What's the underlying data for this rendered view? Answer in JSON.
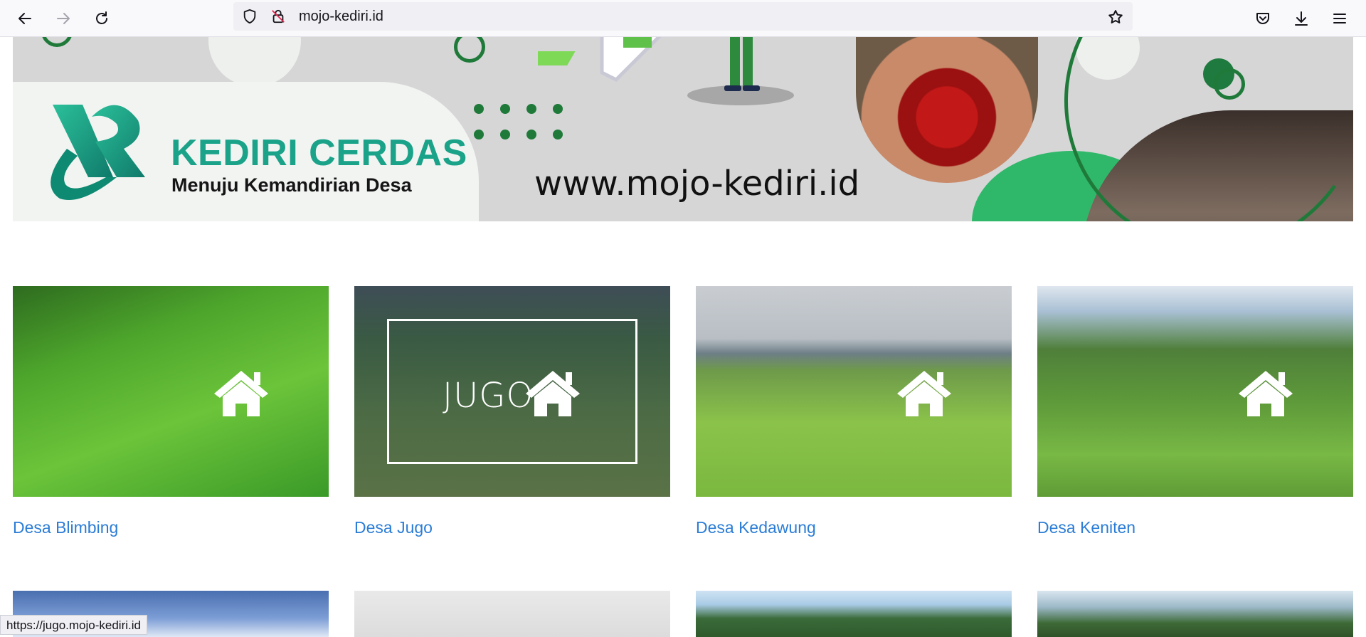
{
  "browser": {
    "url": "mojo-kediri.id",
    "status_url": "https://jugo.mojo-kediri.id"
  },
  "banner": {
    "title": "KEDIRI CERDAS",
    "subtitle": "Menuju Kemandirian Desa",
    "website": "www.mojo-kediri.id",
    "colors": {
      "brand_teal": "#1aa389",
      "dark_green": "#1f7a3a",
      "bright_green": "#2fb86a"
    }
  },
  "villages": [
    {
      "label": "Desa Blimbing"
    },
    {
      "label": "Desa Jugo",
      "hover_overlay": "JUGO"
    },
    {
      "label": "Desa Kedawung"
    },
    {
      "label": "Desa Keniten"
    }
  ],
  "link_color": "#2b7dd6"
}
